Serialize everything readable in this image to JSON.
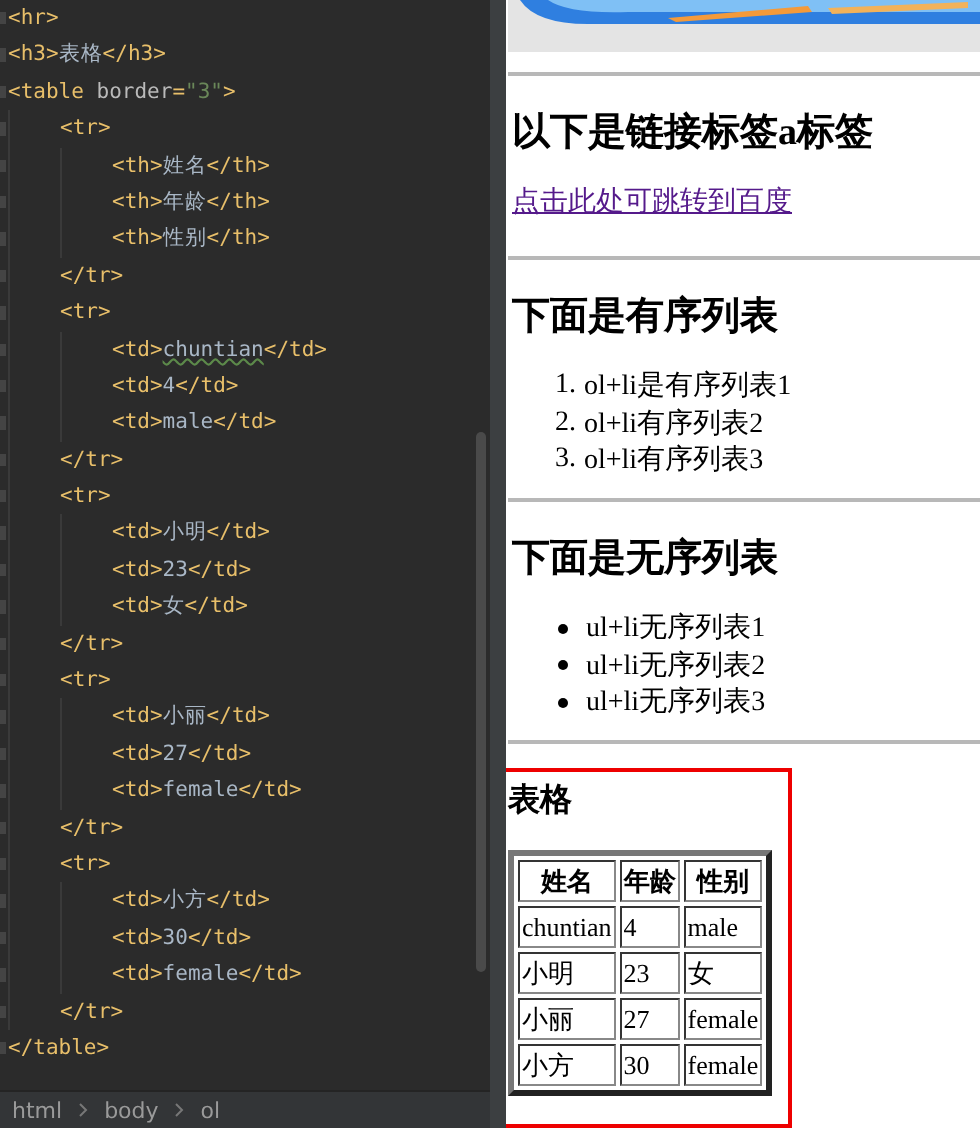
{
  "editor": {
    "lines": [
      {
        "tokens": [
          {
            "kind": "tag",
            "text": "<hr>"
          }
        ]
      },
      {
        "tokens": [
          {
            "kind": "tag",
            "text": "<h3>"
          },
          {
            "kind": "text",
            "text": "表格"
          },
          {
            "kind": "tag",
            "text": "</h3>"
          }
        ]
      },
      {
        "tokens": [
          {
            "kind": "tag",
            "text": "<table "
          },
          {
            "kind": "attr",
            "text": "border"
          },
          {
            "kind": "tag",
            "text": "="
          },
          {
            "kind": "string",
            "text": "\"3\""
          },
          {
            "kind": "tag",
            "text": ">"
          }
        ],
        "children": [
          {
            "tokens": [
              {
                "kind": "tag",
                "text": "<tr>"
              }
            ],
            "children": [
              {
                "tokens": [
                  {
                    "kind": "tag",
                    "text": "<th>"
                  },
                  {
                    "kind": "text",
                    "text": "姓名"
                  },
                  {
                    "kind": "tag",
                    "text": "</th>"
                  }
                ]
              },
              {
                "tokens": [
                  {
                    "kind": "tag",
                    "text": "<th>"
                  },
                  {
                    "kind": "text",
                    "text": "年龄"
                  },
                  {
                    "kind": "tag",
                    "text": "</th>"
                  }
                ]
              },
              {
                "tokens": [
                  {
                    "kind": "tag",
                    "text": "<th>"
                  },
                  {
                    "kind": "text",
                    "text": "性别"
                  },
                  {
                    "kind": "tag",
                    "text": "</th>"
                  }
                ]
              }
            ]
          },
          {
            "tokens": [
              {
                "kind": "tag",
                "text": "</tr>"
              }
            ]
          },
          {
            "tokens": [
              {
                "kind": "tag",
                "text": "<tr>"
              }
            ],
            "children": [
              {
                "tokens": [
                  {
                    "kind": "tag",
                    "text": "<td>"
                  },
                  {
                    "kind": "text",
                    "text": "chuntian",
                    "spell_warning": true
                  },
                  {
                    "kind": "tag",
                    "text": "</td>"
                  }
                ]
              },
              {
                "tokens": [
                  {
                    "kind": "tag",
                    "text": "<td>"
                  },
                  {
                    "kind": "text",
                    "text": "4"
                  },
                  {
                    "kind": "tag",
                    "text": "</td>"
                  }
                ]
              },
              {
                "tokens": [
                  {
                    "kind": "tag",
                    "text": "<td>"
                  },
                  {
                    "kind": "text",
                    "text": "male"
                  },
                  {
                    "kind": "tag",
                    "text": "</td>"
                  }
                ]
              }
            ]
          },
          {
            "tokens": [
              {
                "kind": "tag",
                "text": "</tr>"
              }
            ]
          },
          {
            "tokens": [
              {
                "kind": "tag",
                "text": "<tr>"
              }
            ],
            "children": [
              {
                "tokens": [
                  {
                    "kind": "tag",
                    "text": "<td>"
                  },
                  {
                    "kind": "text",
                    "text": "小明"
                  },
                  {
                    "kind": "tag",
                    "text": "</td>"
                  }
                ]
              },
              {
                "tokens": [
                  {
                    "kind": "tag",
                    "text": "<td>"
                  },
                  {
                    "kind": "text",
                    "text": "23"
                  },
                  {
                    "kind": "tag",
                    "text": "</td>"
                  }
                ]
              },
              {
                "tokens": [
                  {
                    "kind": "tag",
                    "text": "<td>"
                  },
                  {
                    "kind": "text",
                    "text": "女"
                  },
                  {
                    "kind": "tag",
                    "text": "</td>"
                  }
                ]
              }
            ]
          },
          {
            "tokens": [
              {
                "kind": "tag",
                "text": "</tr>"
              }
            ]
          },
          {
            "tokens": [
              {
                "kind": "tag",
                "text": "<tr>"
              }
            ],
            "children": [
              {
                "tokens": [
                  {
                    "kind": "tag",
                    "text": "<td>"
                  },
                  {
                    "kind": "text",
                    "text": "小丽"
                  },
                  {
                    "kind": "tag",
                    "text": "</td>"
                  }
                ]
              },
              {
                "tokens": [
                  {
                    "kind": "tag",
                    "text": "<td>"
                  },
                  {
                    "kind": "text",
                    "text": "27"
                  },
                  {
                    "kind": "tag",
                    "text": "</td>"
                  }
                ]
              },
              {
                "tokens": [
                  {
                    "kind": "tag",
                    "text": "<td>"
                  },
                  {
                    "kind": "text",
                    "text": "female"
                  },
                  {
                    "kind": "tag",
                    "text": "</td>"
                  }
                ]
              }
            ]
          },
          {
            "tokens": [
              {
                "kind": "tag",
                "text": "</tr>"
              }
            ]
          },
          {
            "tokens": [
              {
                "kind": "tag",
                "text": "<tr>"
              }
            ],
            "children": [
              {
                "tokens": [
                  {
                    "kind": "tag",
                    "text": "<td>"
                  },
                  {
                    "kind": "text",
                    "text": "小方"
                  },
                  {
                    "kind": "tag",
                    "text": "</td>"
                  }
                ]
              },
              {
                "tokens": [
                  {
                    "kind": "tag",
                    "text": "<td>"
                  },
                  {
                    "kind": "text",
                    "text": "30"
                  },
                  {
                    "kind": "tag",
                    "text": "</td>"
                  }
                ]
              },
              {
                "tokens": [
                  {
                    "kind": "tag",
                    "text": "<td>"
                  },
                  {
                    "kind": "text",
                    "text": "female"
                  },
                  {
                    "kind": "tag",
                    "text": "</td>"
                  }
                ]
              }
            ]
          },
          {
            "tokens": [
              {
                "kind": "tag",
                "text": "</tr>"
              }
            ]
          }
        ]
      },
      {
        "tokens": [
          {
            "kind": "tag",
            "text": "</table>"
          }
        ]
      }
    ],
    "breadcrumb": [
      "html",
      "body",
      "ol"
    ]
  },
  "preview": {
    "sections": [
      {
        "kind": "picture"
      },
      {
        "kind": "rule"
      },
      {
        "kind": "heading",
        "text": "以下是链接标签a标签"
      },
      {
        "kind": "link",
        "text": "点击此处可跳转到百度"
      },
      {
        "kind": "rule"
      },
      {
        "kind": "heading",
        "text": "下面是有序列表"
      },
      {
        "kind": "ordered",
        "items": [
          {
            "marker": "1.",
            "text": "ol+li是有序列表1"
          },
          {
            "marker": "2.",
            "text": "ol+li有序列表2"
          },
          {
            "marker": "3.",
            "text": "ol+li有序列表3"
          }
        ]
      },
      {
        "kind": "rule"
      },
      {
        "kind": "heading",
        "text": "下面是无序列表"
      },
      {
        "kind": "unordered",
        "items": [
          {
            "text": "ul+li无序列表1"
          },
          {
            "text": "ul+li无序列表2"
          },
          {
            "text": "ul+li无序列表3"
          }
        ]
      },
      {
        "kind": "rule"
      },
      {
        "kind": "table",
        "highlighted": true,
        "title": "表格",
        "columns": [
          "姓名",
          "年龄",
          "性别"
        ],
        "rows": [
          [
            "chuntian",
            "4",
            "male"
          ],
          [
            "小明",
            "23",
            "女"
          ],
          [
            "小丽",
            "27",
            "female"
          ],
          [
            "小方",
            "30",
            "female"
          ]
        ]
      }
    ]
  }
}
